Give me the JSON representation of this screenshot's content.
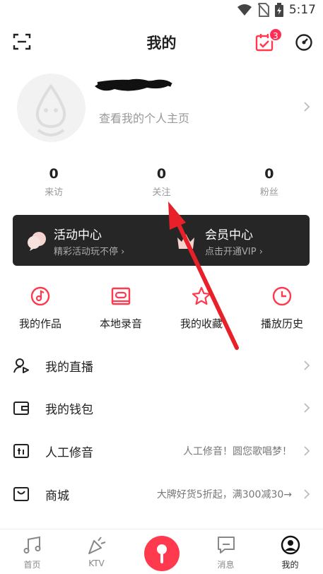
{
  "status_bar": {
    "time": "5:17"
  },
  "header": {
    "title": "我的",
    "calendar_badge": "3"
  },
  "profile": {
    "username": "",
    "link_text": "查看我的个人主页"
  },
  "stats": [
    {
      "value": "0",
      "label": "来访"
    },
    {
      "value": "0",
      "label": "关注"
    },
    {
      "value": "0",
      "label": "粉丝"
    }
  ],
  "banner": {
    "activity": {
      "title": "活动中心",
      "subtitle": "精彩活动玩不停 ›"
    },
    "vip": {
      "title": "会员中心",
      "subtitle": "点击开通VIP ›"
    }
  },
  "quick_actions": [
    {
      "label": "我的作品",
      "icon": "music-disc-icon"
    },
    {
      "label": "本地录音",
      "icon": "cassette-icon"
    },
    {
      "label": "我的收藏",
      "icon": "star-icon"
    },
    {
      "label": "播放历史",
      "icon": "clock-icon"
    }
  ],
  "menu": [
    {
      "label": "我的直播",
      "hint": "",
      "icon": "live-user-icon"
    },
    {
      "label": "我的钱包",
      "hint": "",
      "icon": "wallet-icon"
    },
    {
      "label": "人工修音",
      "hint": "人工修音！圆您歌唱梦！",
      "icon": "equalizer-icon"
    },
    {
      "label": "商城",
      "hint": "大牌好货5折起，满300减30→",
      "icon": "shop-icon"
    }
  ],
  "tabbar": [
    {
      "label": "首页",
      "icon": "music-note-icon"
    },
    {
      "label": "KTV",
      "icon": "party-popper-icon"
    },
    {
      "label": "",
      "icon": "microphone-icon"
    },
    {
      "label": "消息",
      "icon": "message-icon"
    },
    {
      "label": "我的",
      "icon": "user-circle-icon"
    }
  ],
  "colors": {
    "accent": "#ff3a4f",
    "banner_bg": "#262626",
    "annotation_arrow": "#e8202a"
  }
}
